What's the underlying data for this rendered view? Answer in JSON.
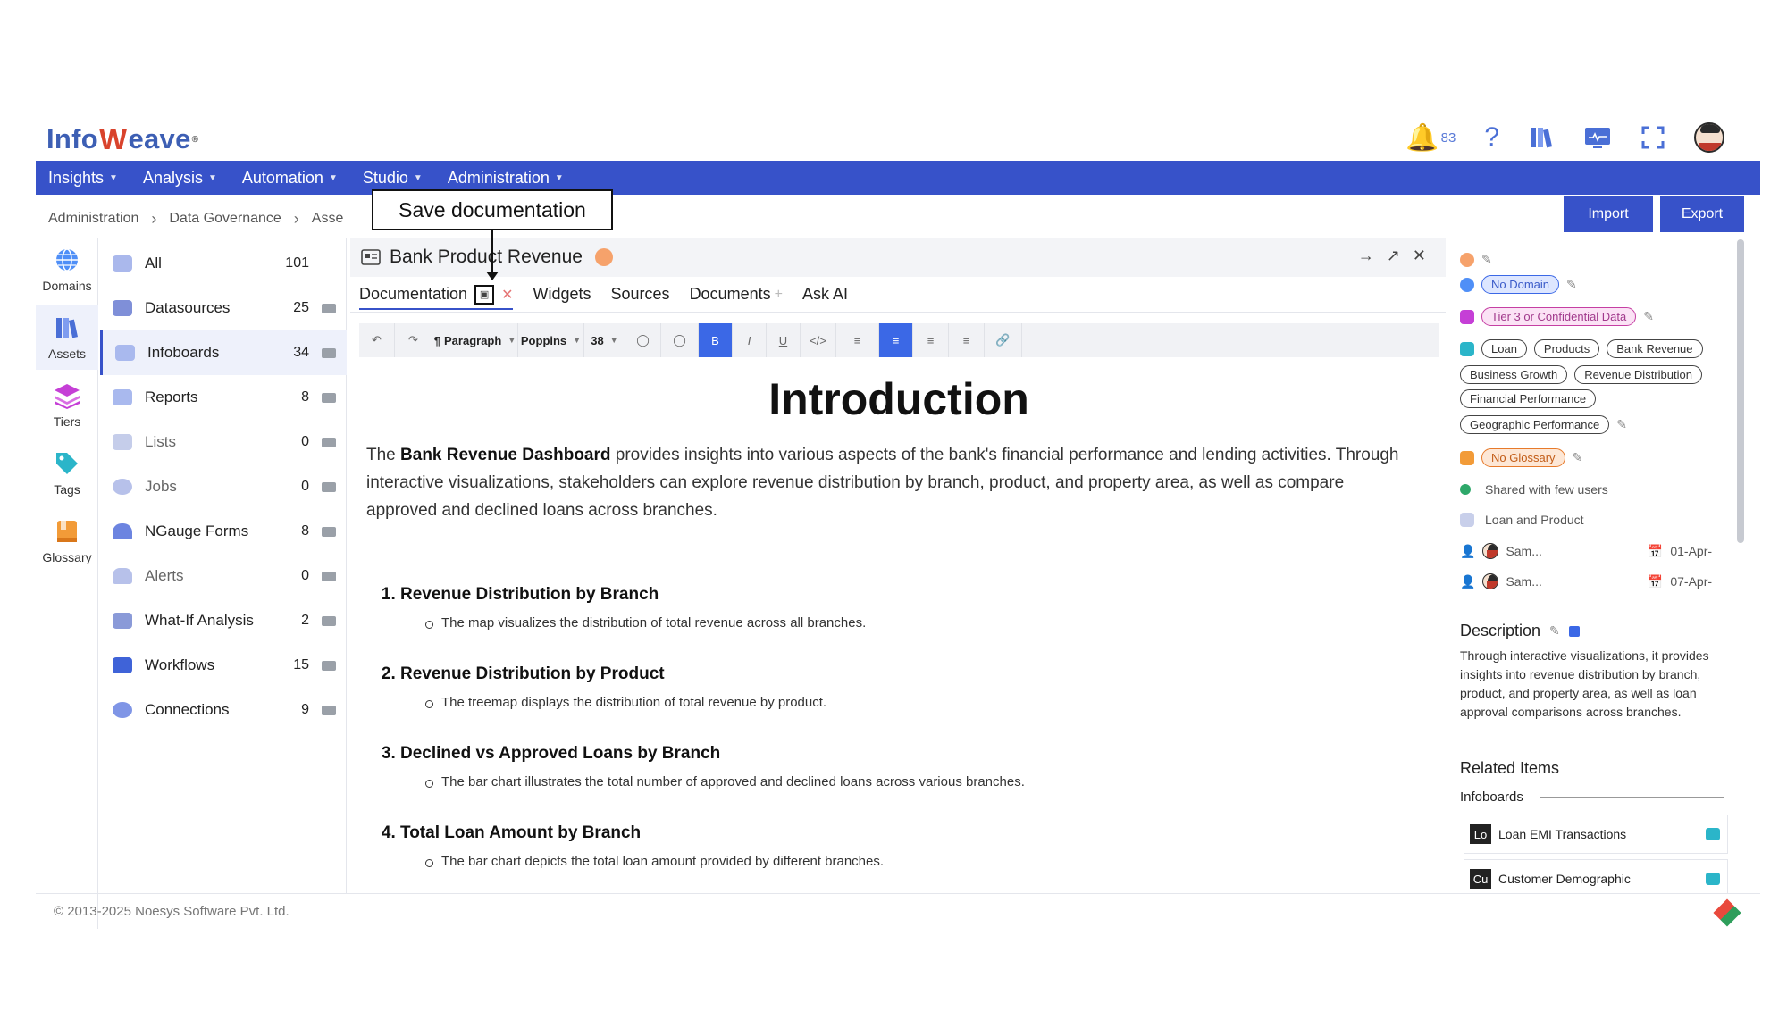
{
  "brand": {
    "pre": "Info",
    "w": "W",
    "post": "eave",
    "mark": "®"
  },
  "header": {
    "notif_count": "83"
  },
  "nav": [
    {
      "label": "Insights"
    },
    {
      "label": "Analysis"
    },
    {
      "label": "Automation"
    },
    {
      "label": "Studio"
    },
    {
      "label": "Administration"
    }
  ],
  "breadcrumb": {
    "items": [
      "Administration",
      "Data Governance",
      "Asse"
    ]
  },
  "tooltip": {
    "text": "Save documentation"
  },
  "actions": {
    "import": "Import",
    "export": "Export"
  },
  "rail": [
    {
      "label": "Domains",
      "color": "#4f8ff7"
    },
    {
      "label": "Assets",
      "color": "#4a6fd6"
    },
    {
      "label": "Tiers",
      "color": "#c53fd6"
    },
    {
      "label": "Tags",
      "color": "#2bb5c9"
    },
    {
      "label": "Glossary",
      "color": "#f29b38"
    }
  ],
  "assets": [
    {
      "label": "All",
      "count": "101"
    },
    {
      "label": "Datasources",
      "count": "25"
    },
    {
      "label": "Infoboards",
      "count": "34"
    },
    {
      "label": "Reports",
      "count": "8"
    },
    {
      "label": "Lists",
      "count": "0"
    },
    {
      "label": "Jobs",
      "count": "0"
    },
    {
      "label": "NGauge Forms",
      "count": "8"
    },
    {
      "label": "Alerts",
      "count": "0"
    },
    {
      "label": "What-If Analysis",
      "count": "2"
    },
    {
      "label": "Workflows",
      "count": "15"
    },
    {
      "label": "Connections",
      "count": "9"
    }
  ],
  "panel": {
    "title": "Bank Product Revenue"
  },
  "tabs": {
    "documentation": "Documentation",
    "widgets": "Widgets",
    "sources": "Sources",
    "documents": "Documents",
    "ask_ai": "Ask AI"
  },
  "toolbar": {
    "paragraph": "Paragraph",
    "font": "Poppins",
    "size": "38"
  },
  "doc": {
    "heading": "Introduction",
    "intro_pre": "The ",
    "intro_bold": "Bank Revenue Dashboard",
    "intro_post": " provides insights into various aspects of the bank's financial performance and lending activities. Through interactive visualizations, stakeholders can explore revenue distribution by branch, product, and property area, as well as compare approved and declined loans across branches.",
    "items": [
      {
        "title": "Revenue Distribution by Branch",
        "desc": "The map visualizes the distribution of total revenue across all branches."
      },
      {
        "title": "Revenue Distribution by Product",
        "desc": "The treemap displays the distribution of total revenue by product."
      },
      {
        "title": "Declined vs Approved Loans by Branch",
        "desc": "The bar chart illustrates the total number of approved and declined loans across various branches."
      },
      {
        "title": "Total Loan Amount by Branch",
        "desc": "The bar chart depicts the total loan amount provided by different branches."
      }
    ]
  },
  "details": {
    "domain": "No Domain",
    "tier": "Tier 3 or Confidential Data",
    "tags": [
      "Loan",
      "Products",
      "Bank Revenue",
      "Business Growth",
      "Revenue Distribution",
      "Financial Performance",
      "Geographic Performance"
    ],
    "glossary": "No Glossary",
    "shared": "Shared with few users",
    "folder": "Loan and Product",
    "created_by": "Sam...",
    "created_on": "01-Apr-",
    "modified_by": "Sam...",
    "modified_on": "07-Apr-",
    "description_label": "Description",
    "description": "Through interactive visualizations, it provides insights into revenue distribution by branch, product, and property area, as well as loan approval comparisons across branches.",
    "related_label": "Related Items",
    "related_group": "Infoboards",
    "related": [
      {
        "abbr": "Lo",
        "label": "Loan EMI Transactions"
      },
      {
        "abbr": "Cu",
        "label": "Customer Demographic"
      }
    ]
  },
  "footer": {
    "copyright": "© 2013-2025 Noesys Software Pvt. Ltd."
  }
}
